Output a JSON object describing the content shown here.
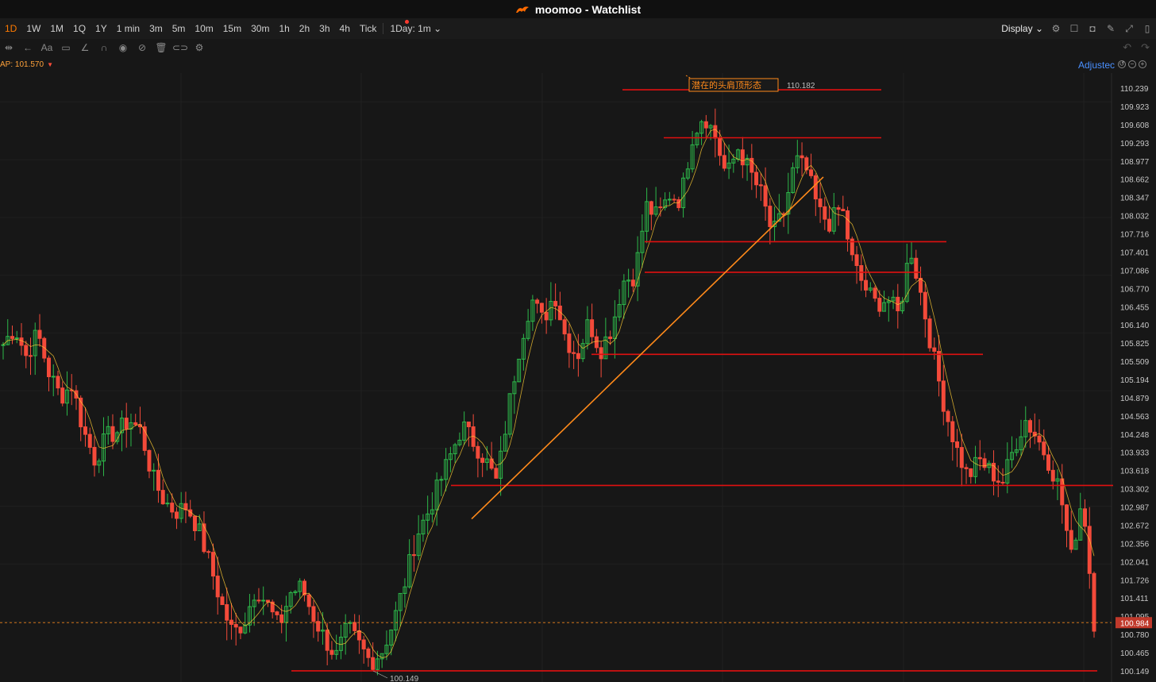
{
  "window": {
    "title": "moomoo - Watchlist"
  },
  "toolbar": {
    "timeframes": [
      "1D",
      "1W",
      "1M",
      "1Q",
      "1Y",
      "1 min",
      "3m",
      "5m",
      "10m",
      "15m",
      "30m",
      "1h",
      "2h",
      "3h",
      "4h",
      "Tick"
    ],
    "active_timeframe": "1D",
    "session_select": "1Day: 1m",
    "display_label": "Display"
  },
  "indicator": {
    "label": "AP:",
    "value": "101.570"
  },
  "adjust_label": "Adjustec",
  "colors": {
    "up": "#2db84a",
    "down": "#f34a3a",
    "line": "#e01010",
    "trend": "#ff8a1a",
    "accent": "#ff7a00"
  },
  "chart_data": {
    "type": "candlestick",
    "annotation": "潜在的头肩顶形态",
    "high_label": "110.182",
    "low_label": "100.149",
    "current_price": "100.984",
    "ylim": [
      100.149,
      110.239
    ],
    "y_ticks": [
      "110.239",
      "109.923",
      "109.608",
      "109.293",
      "108.977",
      "108.662",
      "108.347",
      "108.032",
      "107.716",
      "107.401",
      "107.086",
      "106.770",
      "106.455",
      "106.140",
      "105.825",
      "105.509",
      "105.194",
      "104.879",
      "104.563",
      "104.248",
      "103.933",
      "103.618",
      "103.302",
      "102.987",
      "102.672",
      "102.356",
      "102.041",
      "101.726",
      "101.411",
      "101.095",
      "100.780",
      "100.465",
      "100.149"
    ],
    "horizontal_levels": [
      110.21,
      109.38,
      107.58,
      107.05,
      105.63,
      103.36,
      100.15
    ],
    "trendline": {
      "from": 102.78,
      "to": 108.7
    },
    "price_path": [
      105.8,
      106.1,
      105.6,
      106.0,
      105.3,
      104.9,
      105.1,
      104.3,
      103.8,
      104.2,
      104.3,
      104.5,
      104.3,
      103.5,
      103.1,
      102.9,
      103.0,
      102.6,
      102.0,
      101.3,
      100.8,
      101.0,
      101.6,
      101.3,
      100.9,
      101.5,
      101.6,
      101.1,
      100.7,
      100.4,
      100.9,
      100.6,
      100.3,
      100.5,
      101.0,
      101.7,
      102.5,
      102.9,
      103.4,
      103.9,
      104.4,
      104.1,
      103.8,
      103.4,
      104.7,
      105.8,
      106.6,
      106.2,
      106.7,
      105.9,
      105.6,
      106.2,
      105.7,
      106.1,
      106.9,
      107.0,
      108.2,
      108.0,
      108.4,
      108.3,
      109.4,
      109.8,
      109.4,
      108.7,
      109.2,
      108.8,
      108.4,
      107.7,
      108.1,
      109.0,
      108.8,
      108.1,
      107.9,
      108.2,
      107.2,
      106.8,
      106.5,
      106.6,
      106.3,
      107.5,
      106.6,
      105.6,
      104.7,
      104.0,
      103.5,
      103.8,
      103.6,
      103.4,
      104.0,
      104.5,
      104.2,
      103.8,
      103.3,
      102.1,
      103.2,
      101.0
    ],
    "grid": true
  }
}
